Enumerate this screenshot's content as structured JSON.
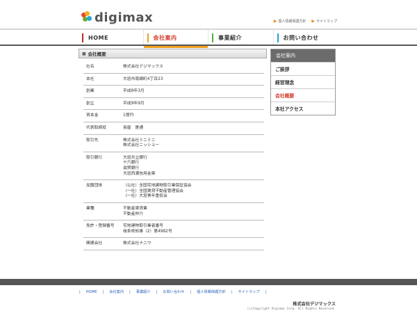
{
  "header": {
    "logo_text": "digimax",
    "top_links": [
      "個人情報保護方針",
      "サイトマップ"
    ]
  },
  "global_nav": [
    {
      "label": "HOME",
      "color": "#c8242b"
    },
    {
      "label": "会社案内",
      "color": "#f0a020"
    },
    {
      "label": "事業紹介",
      "color": "#4caf35"
    },
    {
      "label": "お問い合わせ",
      "color": "#2a9fd6"
    }
  ],
  "section": {
    "title": "会社概要"
  },
  "company_table": [
    {
      "key": "社名",
      "values": [
        "株式会社デジマックス"
      ]
    },
    {
      "key": "本社",
      "values": [
        "大垣市南頬町4丁目23"
      ]
    },
    {
      "key": "創業",
      "values": [
        "平成8年3月"
      ]
    },
    {
      "key": "創立",
      "values": [
        "平成9年9月"
      ]
    },
    {
      "key": "資本金",
      "values": [
        "1億円"
      ]
    },
    {
      "key": "代表取締役",
      "values": [
        "長屋　是通"
      ]
    },
    {
      "key": "取引先",
      "values": [
        "株式会社ミニミニ",
        "株式会社ニッショー"
      ]
    },
    {
      "key": "取引銀行",
      "values": [
        "大垣共立銀行",
        "十六銀行",
        "滋賀銀行",
        "大垣西濃信用金庫"
      ]
    },
    {
      "key": "加盟団体",
      "values": [
        "（公社）全国宅地建物取引業保証協会",
        "（一社）全国賃貸不動産管理協会",
        "（一社）大垣青年重役会"
      ]
    },
    {
      "key": "業種",
      "values": [
        "不動産賃貸業",
        "不動産仲介"
      ]
    },
    {
      "key": "免許・登録番号",
      "values": [
        "宅地建物取引業者番号",
        "岐阜県知事（2）第4982号"
      ]
    },
    {
      "key": "関連会社",
      "values": [
        "株式会社ナニワ"
      ]
    }
  ],
  "sub_nav": {
    "header": "会社案内",
    "items": [
      "ご挨拶",
      "経営理念",
      "会社概要",
      "本社アクセス"
    ],
    "active_index": 2
  },
  "footer": {
    "links": [
      "HOME",
      "会社案内",
      "事業紹介",
      "お問い合わせ",
      "個人情報保護方針",
      "サイトマップ"
    ],
    "company": "株式会社デジマックス",
    "copyright": "(c)Copyright Digimax Corp. All Rights Reserved."
  }
}
